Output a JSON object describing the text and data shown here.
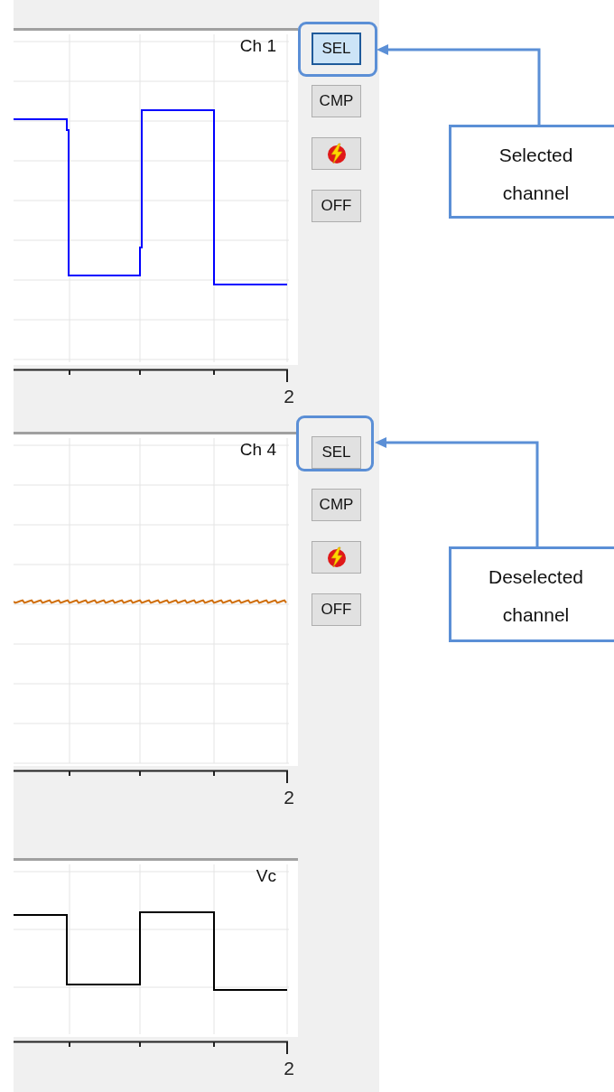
{
  "channels": [
    {
      "label": "Ch 1",
      "kind": "square",
      "color": "#0000ff",
      "x_tick_label": "2",
      "buttons": [
        {
          "label": "SEL",
          "kind": "text",
          "selected": true
        },
        {
          "label": "CMP",
          "kind": "text",
          "selected": false
        },
        {
          "kind": "icon",
          "selected": false
        },
        {
          "label": "OFF",
          "kind": "text",
          "selected": false
        }
      ]
    },
    {
      "label": "Ch 4",
      "kind": "flat",
      "color": "#d07010",
      "x_tick_label": "2",
      "buttons": [
        {
          "label": "SEL",
          "kind": "text",
          "selected": false
        },
        {
          "label": "CMP",
          "kind": "text",
          "selected": false
        },
        {
          "kind": "icon",
          "selected": false
        },
        {
          "label": "OFF",
          "kind": "text",
          "selected": false
        }
      ]
    },
    {
      "label": "Vc",
      "kind": "square",
      "color": "#000000",
      "x_tick_label": "2"
    }
  ],
  "callouts": [
    {
      "text": "Selected channel"
    },
    {
      "text": "Deselected channel"
    }
  ]
}
